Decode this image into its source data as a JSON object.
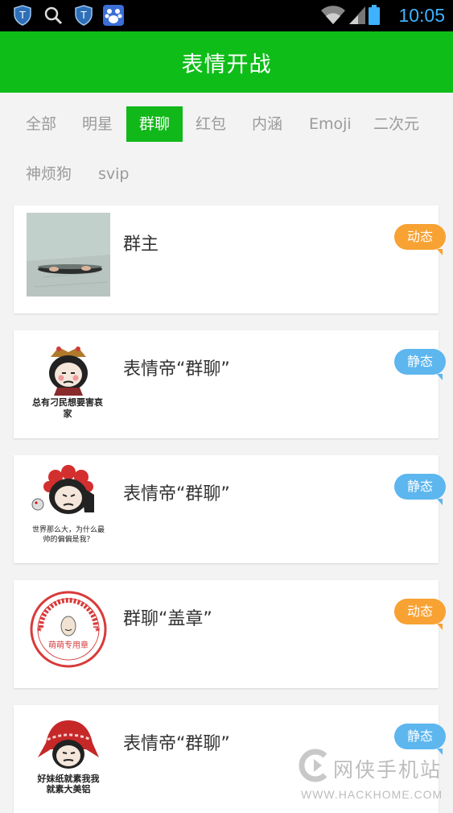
{
  "status_bar": {
    "time": "10:05",
    "icons": [
      "shield-icon",
      "search-icon",
      "shield-icon",
      "paw-icon",
      "wifi-icon",
      "signal-icon",
      "battery-icon"
    ]
  },
  "header": {
    "title": "表情开战"
  },
  "tabs": [
    {
      "label": "全部",
      "active": false
    },
    {
      "label": "明星",
      "active": false
    },
    {
      "label": "群聊",
      "active": true
    },
    {
      "label": "红包",
      "active": false
    },
    {
      "label": "内涵",
      "active": false
    },
    {
      "label": "Emoji",
      "active": false
    },
    {
      "label": "二次元",
      "active": false
    },
    {
      "label": "神烦狗",
      "active": false
    },
    {
      "label": "svip",
      "active": false
    }
  ],
  "items": [
    {
      "title": "群主",
      "badge": "动态",
      "badge_color": "#f7a233",
      "thumb": "manhole-photo"
    },
    {
      "title": "表情帝“群聊”",
      "badge": "静态",
      "badge_color": "#5db6ee",
      "thumb": "meme-face-crown",
      "caption": "总有刁民想要害哀家"
    },
    {
      "title": "表情帝“群聊”",
      "badge": "静态",
      "badge_color": "#5db6ee",
      "thumb": "meme-face-flowers",
      "caption": "世界那么大，为什么最帅的偏偏是我？"
    },
    {
      "title": "群聊“盖章”",
      "badge": "动态",
      "badge_color": "#f7a233",
      "thumb": "red-stamp",
      "caption": "萌萌专用章"
    },
    {
      "title": "表情帝“群聊”",
      "badge": "静态",
      "badge_color": "#5db6ee",
      "thumb": "meme-face-scarf",
      "caption": "好妹纸就素我我就素大美铝"
    }
  ],
  "watermark": {
    "text": "网侠手机站",
    "url": "WWW.HACKHOME.COM"
  }
}
